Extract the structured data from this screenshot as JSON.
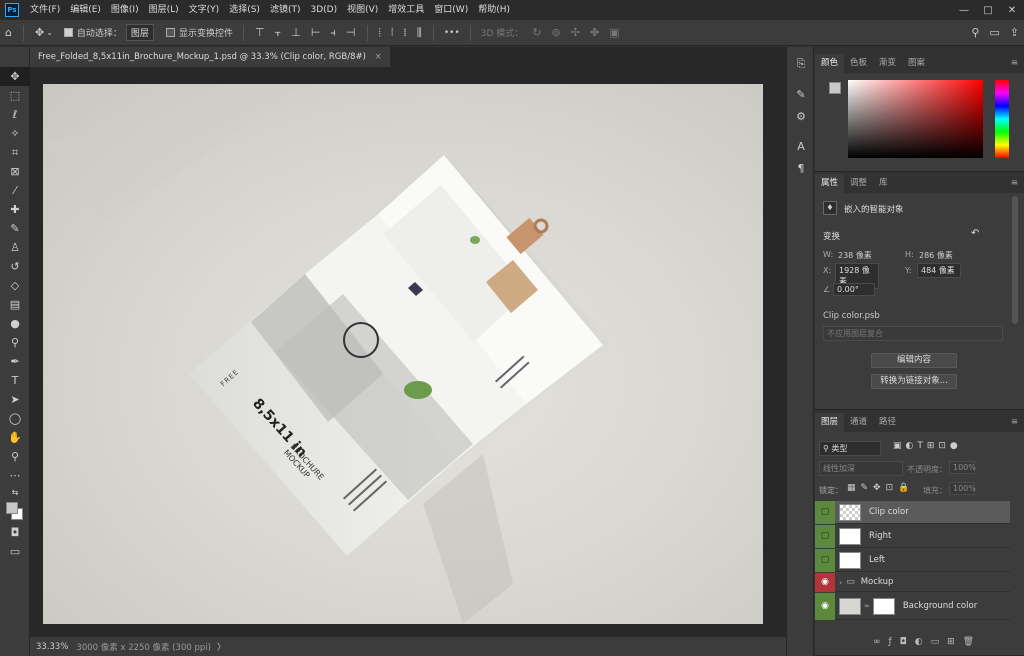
{
  "menubar": {
    "items": [
      "文件(F)",
      "编辑(E)",
      "图像(I)",
      "图层(L)",
      "文字(Y)",
      "选择(S)",
      "滤镜(T)",
      "3D(D)",
      "视图(V)",
      "增效工具",
      "窗口(W)",
      "帮助(H)"
    ],
    "logo": "Ps",
    "minimize": "—",
    "maximize": "□",
    "close": "✕"
  },
  "options": {
    "auto_select_label": "自动选择：",
    "auto_select_value": "图层",
    "show_transform_label": "显示变换控件",
    "more": "•••",
    "mode_3d_label": "3D 模式："
  },
  "document": {
    "tab_title": "Free_Folded_8,5x11in_Brochure_Mockup_1.psd @ 33.3% (Clip color, RGB/8#)",
    "close_icon": "×"
  },
  "status": {
    "zoom": "33.33%",
    "doc_info": "3000 像素 x 2250 像素 (300 ppi)",
    "arrow": "〉"
  },
  "brochure": {
    "free_label": "FREE",
    "size_label": "8,5x11 in",
    "title_line1": "BROCHURE",
    "title_line2": "MOCKUP"
  },
  "color_panel": {
    "tabs": [
      "颜色",
      "色板",
      "渐变",
      "图案"
    ],
    "accent_hue": "#ff0000"
  },
  "properties_panel": {
    "tabs": [
      "属性",
      "调整",
      "库"
    ],
    "type_label": "嵌入的智能对象",
    "transform_label": "变换",
    "w_label": "W:",
    "w_value": "238 像素",
    "h_label": "H:",
    "h_value": "286 像素",
    "x_label": "X:",
    "x_value": "1928 像素",
    "y_label": "Y:",
    "y_value": "484 像素",
    "angle_value": "0.00°",
    "source_file": "Clip color.psb",
    "comp_placeholder": "不应用图层复合",
    "edit_contents_btn": "编辑内容",
    "convert_linked_btn": "转换为链接对象..."
  },
  "layers_panel": {
    "tabs": [
      "图层",
      "通道",
      "路径"
    ],
    "filter_label": "类型",
    "blend_mode": "线性加深",
    "opacity_label": "不透明度：",
    "opacity_value": "100%",
    "lock_label": "锁定：",
    "fill_label": "填充：",
    "fill_value": "100%",
    "layers": [
      {
        "name": "Clip color",
        "eye": "",
        "selected": true
      },
      {
        "name": "Right",
        "eye": "",
        "selected": false
      },
      {
        "name": "Left",
        "eye": "",
        "selected": false
      },
      {
        "name": "Mockup",
        "eye": "👁",
        "selected": false,
        "group": true
      },
      {
        "name": "Background color",
        "eye": "👁",
        "selected": false
      }
    ]
  }
}
